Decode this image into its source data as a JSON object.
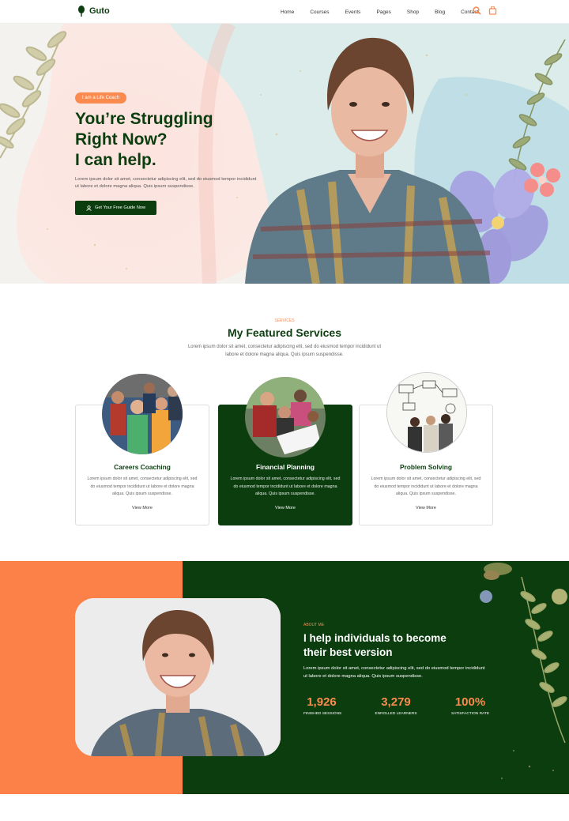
{
  "brand": {
    "name": "Guto",
    "green": "#0b3d0f",
    "orange": "#fb8a4e"
  },
  "nav": {
    "items": [
      "Home",
      "Courses",
      "Events",
      "Pages",
      "Shop",
      "Blog",
      "Contact"
    ],
    "icons": [
      "search-icon",
      "cart-icon"
    ]
  },
  "hero": {
    "badge": "I am a Life Coach",
    "title_line1": "You’re Struggling",
    "title_line2": "Right Now?",
    "title_line3": "I can help.",
    "text": "Lorem ipsum dolor sit amet, consectetur adipiscing elit, sed do eiusmod tempor incididunt ut labore et dolore magna aliqua. Quis ipsum suspendisse.",
    "button": "Get Your Free Guide Now"
  },
  "services": {
    "eyebrow": "SERVICES",
    "title": "My Featured Services",
    "description": "Lorem ipsum dolor sit amet, consectetur adipiscing elit, sed do eiusmod tempor incididunt ut labore et dolore magna aliqua. Quis ipsum suspendisse.",
    "cards": [
      {
        "title": "Careers Coaching",
        "text": "Lorem ipsum dolor sit amet, consectetur adipiscing elit, sed do eiusmod tempor incididunt ut labore et dolore magna aliqua. Quis ipsum suspendisse.",
        "link": "View More"
      },
      {
        "title": "Financial Planning",
        "text": "Lorem ipsum dolor sit amet, consectetur adipiscing elit, sed do eiusmod tempor incididunt ut labore et dolore magna aliqua. Quis ipsum suspendisse.",
        "link": "View More"
      },
      {
        "title": "Problem Solving",
        "text": "Lorem ipsum dolor sit amet, consectetur adipiscing elit, sed do eiusmod tempor incididunt ut labore et dolore magna aliqua. Quis ipsum suspendisse.",
        "link": "View More"
      }
    ]
  },
  "about": {
    "eyebrow": "ABOUT ME",
    "title_line1": "I help individuals to become",
    "title_line2": "their best version",
    "text": "Lorem ipsum dolor sit amet, consectetur adipiscing elit, sed do eiusmod tempor incididunt ut labore et dolore magna aliqua. Quis ipsum suspendisse.",
    "stats": [
      {
        "value": "1,926",
        "label": "FINISHED SESSIONS"
      },
      {
        "value": "3,279",
        "label": "ENROLLED LEARNERS"
      },
      {
        "value": "100%",
        "label": "SATISFACTION RATE"
      }
    ]
  }
}
